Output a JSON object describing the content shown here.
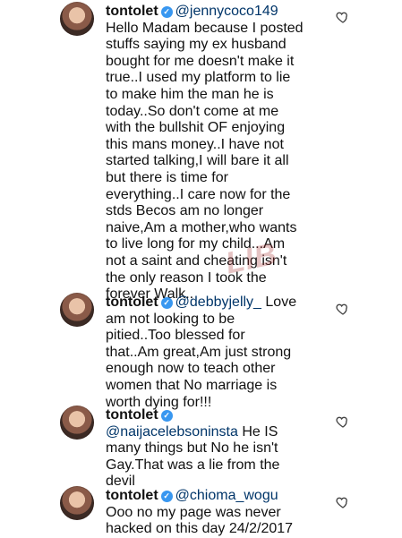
{
  "comments": [
    {
      "username": "tontolet",
      "mention": "@jennycoco149",
      "text": "Hello Madam because I posted\nstuffs saying my ex husband\nbought for me doesn't make it\ntrue..I used my platform to lie\nto make him the man he is\ntoday..So don't come at me\nwith the bullshit OF enjoying\nthis mans money..I have not\nstarted talking,I will bare it all\nbut there is time for\neverything..I care now for the\nstds Becos am no longer\nnaive,Am a mother,who wants\nto live long for my child...Am\nnot a saint and cheating isn't\nthe only reason I took the\nforever Walk.."
    },
    {
      "username": "tontolet",
      "mention": "@debbyjelly_",
      "text": "Love\nam not looking to be\npitied..Too blessed for\nthat..Am great,Am just strong\nenough now to teach other\nwomen that No marriage is\nworth dying for!!!"
    },
    {
      "username": "tontolet",
      "mention": "@naijacelebsoninsta",
      "text": "He IS\nmany things but No he isn't\nGay.That was a lie from the\ndevil"
    },
    {
      "username": "tontolet",
      "mention": "@chioma_wogu",
      "text": "Ooo no my page was never\nhacked on this day 24/2/2017"
    }
  ],
  "icons": {
    "verified": "verified-badge-icon",
    "like": "heart-outline-icon"
  },
  "watermark": "LIB",
  "colors": {
    "verified": "#3897f0",
    "mention": "#003569",
    "text": "#111111"
  }
}
